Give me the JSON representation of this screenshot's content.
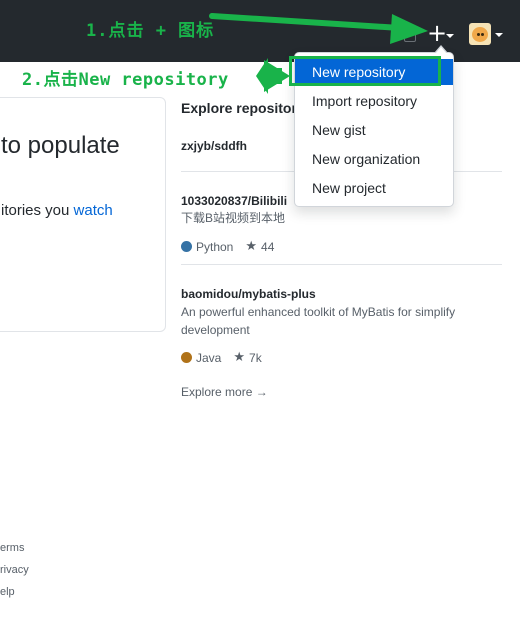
{
  "annotations": {
    "step1": "1.点击 + 图标",
    "step2": "2.点击New repository",
    "color": "#19b34a"
  },
  "header": {
    "plus_label": "+",
    "icons": [
      "plus-icon",
      "bell-icon",
      "avatar"
    ]
  },
  "dropdown": {
    "items": [
      {
        "label": "New repository",
        "active": true
      },
      {
        "label": "Import repository"
      },
      {
        "label": "New gist"
      },
      {
        "label": "New organization"
      },
      {
        "label": "New project"
      }
    ]
  },
  "card": {
    "title": "to populate",
    "text_prefix": "itories you ",
    "link": "watch"
  },
  "explore": {
    "heading": "Explore repositories",
    "repos": [
      {
        "name": "zxjyb/sddfh"
      },
      {
        "name": "1033020837/Bilibili",
        "description": "下载B站视频到本地",
        "language": "Python",
        "language_color": "#3572A5",
        "stars": "44"
      },
      {
        "name": "baomidou/mybatis-plus",
        "description": "An powerful enhanced toolkit of MyBatis for simplify development",
        "language": "Java",
        "language_color": "#b07219",
        "stars": "7k"
      }
    ],
    "more": "Explore more →"
  },
  "footer": {
    "links": [
      "erms",
      "rivacy",
      "elp"
    ]
  }
}
